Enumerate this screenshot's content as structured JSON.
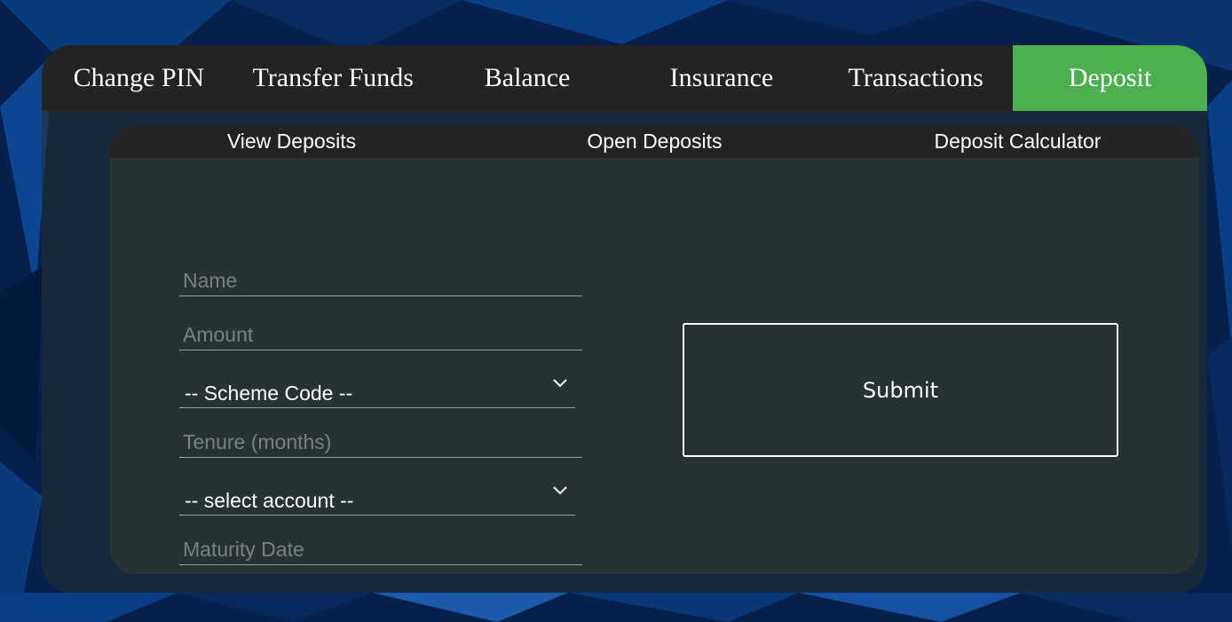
{
  "main_tabs": [
    {
      "label": "Change PIN"
    },
    {
      "label": "Transfer Funds"
    },
    {
      "label": "Balance"
    },
    {
      "label": "Insurance"
    },
    {
      "label": "Transactions"
    },
    {
      "label": "Deposit",
      "active": true
    }
  ],
  "sub_tabs": [
    {
      "label": "View Deposits"
    },
    {
      "label": "Open Deposits"
    },
    {
      "label": "Deposit Calculator"
    }
  ],
  "form": {
    "name": {
      "placeholder": "Name",
      "value": ""
    },
    "amount": {
      "placeholder": "Amount",
      "value": ""
    },
    "scheme_code": {
      "selected": "-- Scheme Code --"
    },
    "tenure": {
      "placeholder": "Tenure (months)",
      "value": ""
    },
    "account": {
      "selected": "-- select account --"
    },
    "maturity_date": {
      "placeholder": "Maturity Date",
      "value": ""
    },
    "submit_label": "Submit"
  },
  "colors": {
    "active_tab": "#4caf50",
    "tab_bar": "#232323",
    "panel": "#263332",
    "background": "#05204a"
  },
  "icons": {
    "dropdown": "chevron-down-icon"
  }
}
